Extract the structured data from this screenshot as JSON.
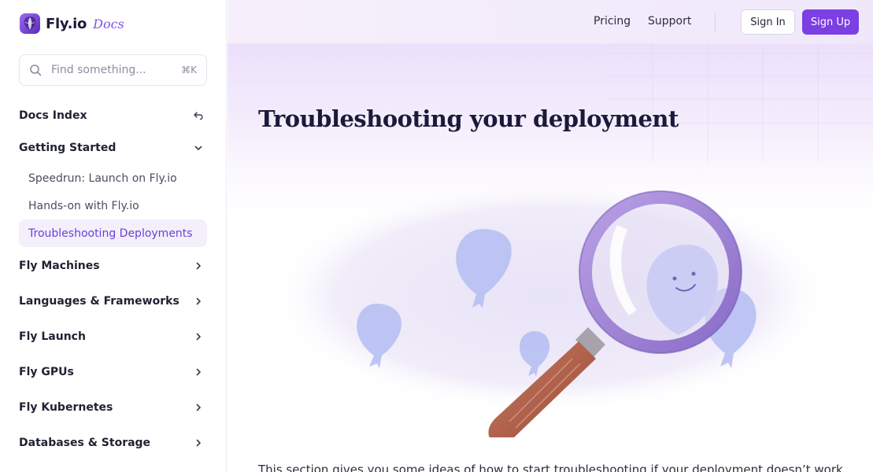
{
  "brand": {
    "name": "Fly.io",
    "sub": "Docs"
  },
  "search": {
    "placeholder": "Find something...",
    "shortcut": "⌘K"
  },
  "sidebar": {
    "items": [
      {
        "label": "Docs Index",
        "icon": "return-icon"
      },
      {
        "label": "Getting Started",
        "icon": "chevron-down-icon"
      },
      {
        "label": "Fly Machines",
        "icon": "chevron-right-icon"
      },
      {
        "label": "Languages & Frameworks",
        "icon": "chevron-right-icon"
      },
      {
        "label": "Fly Launch",
        "icon": "chevron-right-icon"
      },
      {
        "label": "Fly GPUs",
        "icon": "chevron-right-icon"
      },
      {
        "label": "Fly Kubernetes",
        "icon": "chevron-right-icon"
      },
      {
        "label": "Databases & Storage",
        "icon": "chevron-right-icon"
      }
    ],
    "sub_items": [
      {
        "label": "Speedrun: Launch on Fly.io",
        "active": false
      },
      {
        "label": "Hands-on with Fly.io",
        "active": false
      },
      {
        "label": "Troubleshooting Deployments",
        "active": true
      }
    ]
  },
  "header": {
    "links": [
      "Pricing",
      "Support"
    ],
    "sign_in": "Sign In",
    "sign_up": "Sign Up"
  },
  "page": {
    "title": "Troubleshooting your deployment",
    "intro": "This section gives you some ideas of how to start troubleshooting if your deployment doesn’t work"
  },
  "colors": {
    "accent": "#7b3fe4",
    "active_bg": "#f3f0fb",
    "active_text": "#6d3fd9"
  }
}
